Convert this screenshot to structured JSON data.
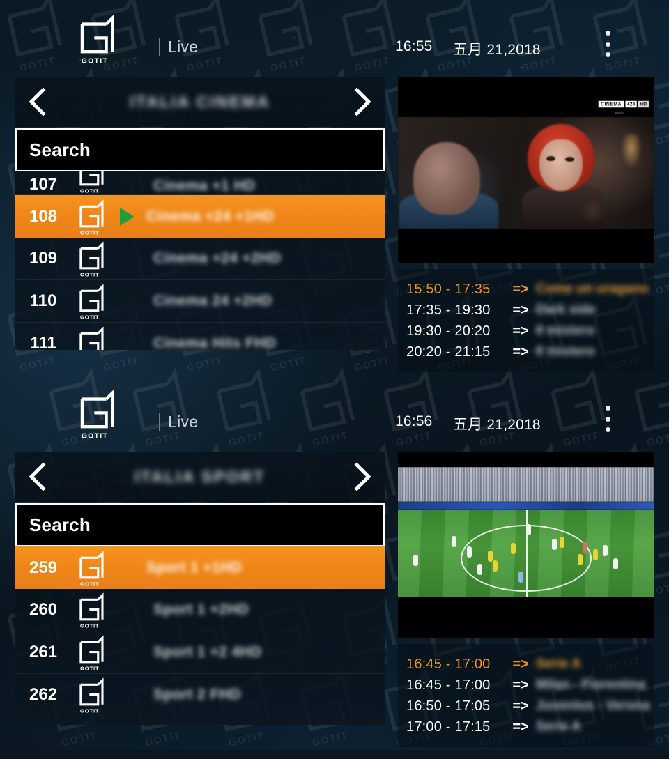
{
  "app": {
    "brand_name": "GOTIT",
    "mode_label": "Live",
    "divider": "|"
  },
  "icons": {
    "menu": "kebab-menu-icon",
    "prev": "chevron-left-icon",
    "next": "chevron-right-icon",
    "play": "play-icon"
  },
  "panels": [
    {
      "id": "cinema",
      "header": {
        "clock": "16:55",
        "date": "五月 21,2018"
      },
      "category": {
        "title": "ITALIA CINEMA"
      },
      "search": {
        "value": "Search",
        "placeholder": "Search"
      },
      "channels": [
        {
          "number": "107",
          "name": "Cinema +1 HD",
          "active": false,
          "playing": false,
          "partial": true
        },
        {
          "number": "108",
          "name": "Cinema +24 +1HD",
          "active": true,
          "playing": true,
          "partial": false
        },
        {
          "number": "109",
          "name": "Cinema +24 +2HD",
          "active": false,
          "playing": false,
          "partial": false
        },
        {
          "number": "110",
          "name": "Cinema 24 +2HD",
          "active": false,
          "playing": false,
          "partial": false
        },
        {
          "number": "111",
          "name": "Cinema Hits FHD",
          "active": false,
          "playing": false,
          "partial": false
        }
      ],
      "preview": {
        "badge_left": "CINEMA",
        "badge_mid": "+24",
        "badge_right": "HD",
        "badge_sub": "web"
      },
      "epg": [
        {
          "time": "15:50 - 17:35",
          "arrow": "=>",
          "title": "Come un uragano",
          "current": true
        },
        {
          "time": "17:35 - 19:30",
          "arrow": "=>",
          "title": "Dark side",
          "current": false
        },
        {
          "time": "19:30 - 20:20",
          "arrow": "=>",
          "title": "Il mistero",
          "current": false
        },
        {
          "time": "20:20 - 21:15",
          "arrow": "=>",
          "title": "Il mistero",
          "current": false
        }
      ]
    },
    {
      "id": "sport",
      "header": {
        "clock": "16:56",
        "date": "五月 21,2018"
      },
      "category": {
        "title": "ITALIA SPORT"
      },
      "search": {
        "value": "Search",
        "placeholder": "Search"
      },
      "channels": [
        {
          "number": "259",
          "name": "Sport 1 +1HD",
          "active": true,
          "playing": false,
          "partial": false
        },
        {
          "number": "260",
          "name": "Sport 1 +2HD",
          "active": false,
          "playing": false,
          "partial": false
        },
        {
          "number": "261",
          "name": "Sport 1 +2 4HD",
          "active": false,
          "playing": false,
          "partial": false
        },
        {
          "number": "262",
          "name": "Sport 2 FHD",
          "active": false,
          "playing": false,
          "partial": false
        }
      ],
      "preview": {
        "badge_left": "",
        "badge_mid": "",
        "badge_right": "",
        "badge_sub": ""
      },
      "epg": [
        {
          "time": "16:45 - 17:00",
          "arrow": "=>",
          "title": "Serie A",
          "current": true
        },
        {
          "time": "16:45 - 17:00",
          "arrow": "=>",
          "title": "Milan - Fiorentina",
          "current": false
        },
        {
          "time": "16:50 - 17:05",
          "arrow": "=>",
          "title": "Juventus - Verona",
          "current": false
        },
        {
          "time": "17:00 - 17:15",
          "arrow": "=>",
          "title": "Serie A",
          "current": false
        }
      ]
    }
  ],
  "colors": {
    "accent_orange": "#ef8518",
    "play_green": "#1f9c3e",
    "panel_bg": "#0a1620",
    "text_primary": "#ffffff"
  }
}
